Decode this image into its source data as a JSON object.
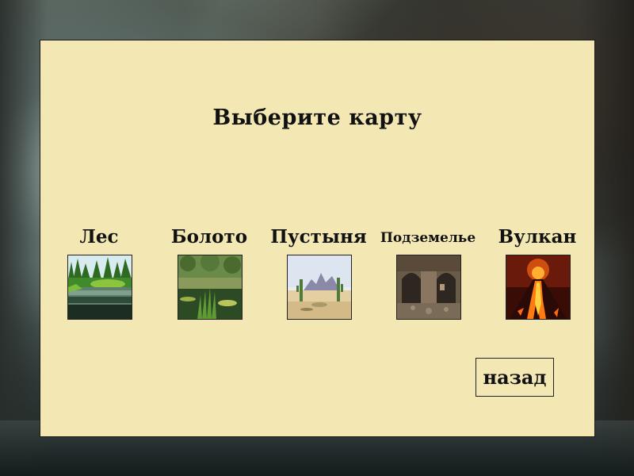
{
  "screen": {
    "title": "Выберите карту"
  },
  "maps": [
    {
      "label": "Лес",
      "thumbnail": "forest-lake-image"
    },
    {
      "label": "Болото",
      "thumbnail": "swamp-image"
    },
    {
      "label": "Пустыня",
      "thumbnail": "desert-cactus-image"
    },
    {
      "label": "Подземелье",
      "thumbnail": "dungeon-ruins-image"
    },
    {
      "label": "Вулкан",
      "thumbnail": "volcano-eruption-image"
    }
  ],
  "buttons": {
    "back_label": "назад"
  },
  "colors": {
    "panel_background": "#f3e7b3",
    "text": "#111111",
    "border": "#222222"
  }
}
